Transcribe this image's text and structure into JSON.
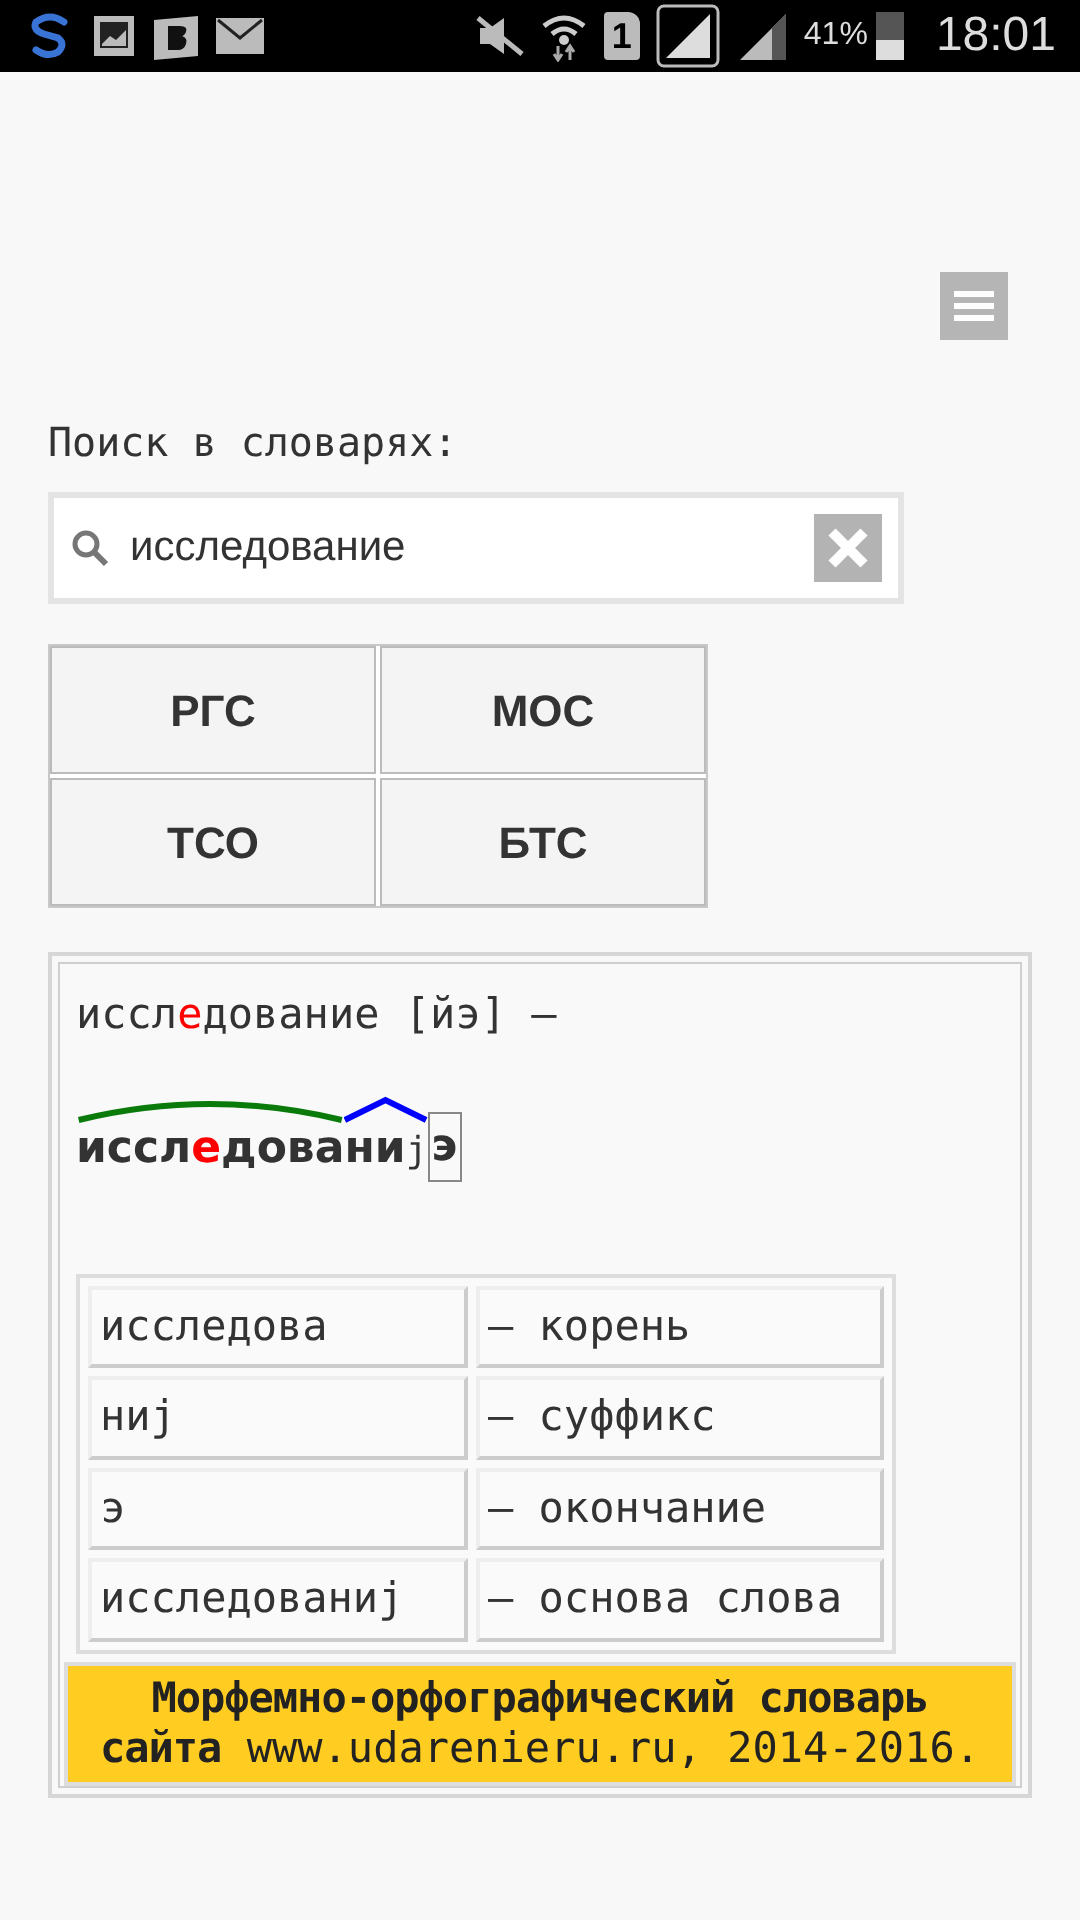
{
  "status_bar": {
    "sim": "1",
    "battery_text": "41%",
    "time": "18:01"
  },
  "search": {
    "label": "Поиск в словарях:",
    "value": "исследование"
  },
  "dictionaries": [
    {
      "label": "РГС"
    },
    {
      "label": "МОС"
    },
    {
      "label": "ТСО"
    },
    {
      "label": "БТС"
    }
  ],
  "entry": {
    "headword": {
      "before": "иссл",
      "stress": "е",
      "after": "дование"
    },
    "transcription": "[йэ]",
    "dash": "–",
    "morphemes": [
      {
        "kind": "root",
        "before": "иссл",
        "stress": "е",
        "after": "дова"
      },
      {
        "kind": "suffix",
        "text": "ни",
        "extra": "j"
      },
      {
        "kind": "ending",
        "text": "э"
      }
    ],
    "parts": [
      {
        "part": "исследова",
        "role": "– корень"
      },
      {
        "part": "ниj",
        "role": "– суффикс"
      },
      {
        "part": "э",
        "role": "– окончание"
      },
      {
        "part": "исследованиj",
        "role": "– основа слова"
      }
    ]
  },
  "footer": {
    "title": "Морфемно-орфографический словарь сайта",
    "source": "www.udarenieru.ru, 2014-2016."
  }
}
